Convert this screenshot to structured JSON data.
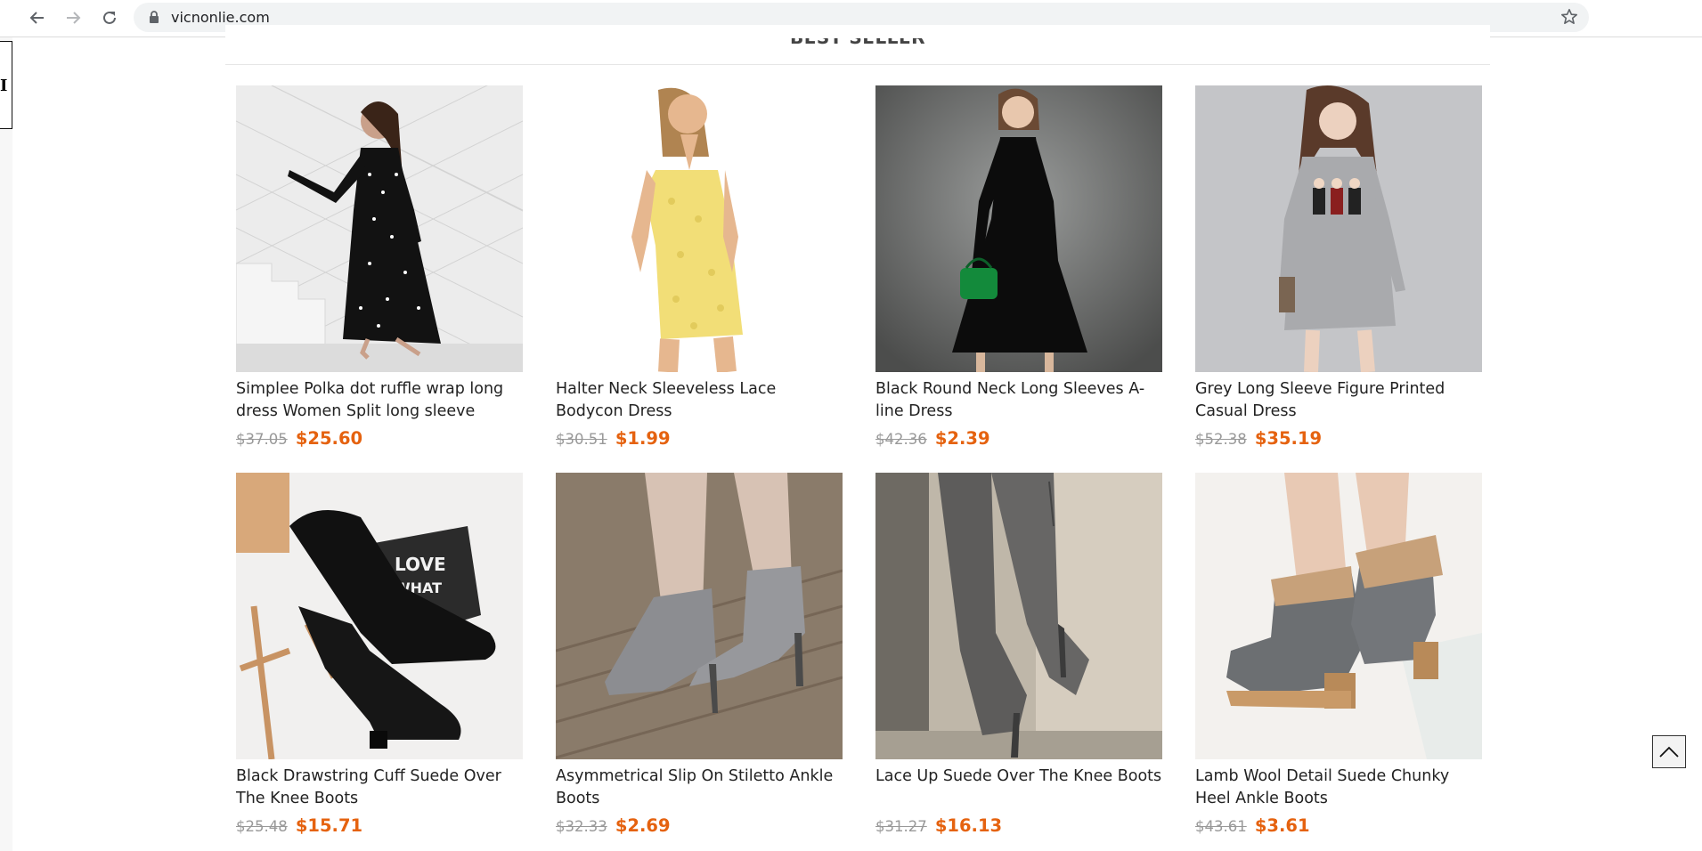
{
  "browser": {
    "url": "vicnonlie.com",
    "back_icon": "arrow-left-icon",
    "forward_icon": "arrow-right-icon",
    "reload_icon": "reload-icon",
    "lock_icon": "lock-icon",
    "bookmark_icon": "star-icon"
  },
  "left_edge_glyph": "I",
  "section": {
    "title": "BEST SELLER"
  },
  "colors": {
    "price_new": "#e5620f",
    "price_old": "#999999",
    "text": "#222222"
  },
  "products": [
    {
      "name": "Simplee Polka dot ruffle wrap long dress Women Split long sleeve",
      "old_price": "$37.05",
      "new_price": "$25.60",
      "image": "woman in black polka dot wrap dress on white stairs"
    },
    {
      "name": "Halter Neck Sleeveless Lace Bodycon Dress",
      "old_price": "$30.51",
      "new_price": "$1.99",
      "image": "woman in yellow lace halter dress"
    },
    {
      "name": "Black Round Neck Long Sleeves A-line Dress",
      "old_price": "$42.36",
      "new_price": "$2.39",
      "image": "woman in black A-line dress with green handbag"
    },
    {
      "name": "Grey Long Sleeve Figure Printed Casual Dress",
      "old_price": "$52.38",
      "new_price": "$35.19",
      "image": "woman in grey printed long sleeve dress"
    },
    {
      "name": "Black Drawstring Cuff Suede Over The Knee Boots",
      "old_price": "$25.48",
      "new_price": "$15.71",
      "image": "black suede over the knee boots with LOVE sign"
    },
    {
      "name": "Asymmetrical Slip On Stiletto Ankle Boots",
      "old_price": "$32.33",
      "new_price": "$2.69",
      "image": "grey stiletto ankle boots on wooden floor"
    },
    {
      "name": "Lace Up Suede Over The Knee Boots",
      "old_price": "$31.27",
      "new_price": "$16.13",
      "image": "grey lace up suede over the knee boots"
    },
    {
      "name": "Lamb Wool Detail Suede Chunky Heel Ankle Boots",
      "old_price": "$43.61",
      "new_price": "$3.61",
      "image": "grey suede ankle boots with wool cuff"
    }
  ],
  "back_to_top_icon": "chevron-up-icon"
}
